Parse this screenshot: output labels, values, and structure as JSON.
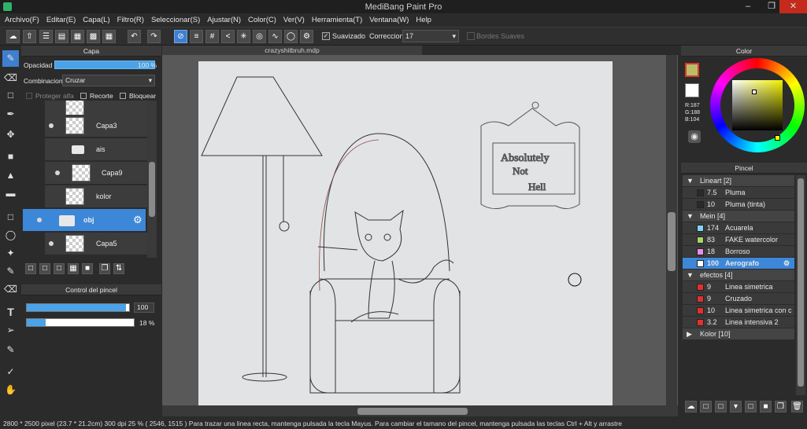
{
  "app": {
    "title": "MediBang Paint Pro"
  },
  "menu": [
    "Archivo(F)",
    "Editar(E)",
    "Capa(L)",
    "Filtro(R)",
    "Seleccionar(S)",
    "Ajustar(N)",
    "Color(C)",
    "Ver(V)",
    "Herramienta(T)",
    "Ventana(W)",
    "Help"
  ],
  "toolbar": {
    "smooth_label": "Suavizado",
    "correction_label": "Correccion",
    "correction_value": "17",
    "soft_edges_label": "Bordes Suaves"
  },
  "document": {
    "tab": "crazyshitbruh.mdp"
  },
  "layers_panel": {
    "title": "Capa",
    "opacity_label": "Opacidad",
    "opacity_value": "100 %",
    "blend_label": "Combinacion",
    "blend_value": "Cruzar",
    "protect_alpha": "Proteger alfa",
    "clipping": "Recorte",
    "lock": "Bloquear",
    "layers": [
      {
        "name": "Capa3"
      },
      {
        "name": "ais"
      },
      {
        "name": "Capa9"
      },
      {
        "name": "kolor"
      },
      {
        "name": "obj"
      },
      {
        "name": "Capa5"
      }
    ]
  },
  "brush_control": {
    "title": "Control del pincel",
    "size_value": "100",
    "opacity_value": "18 %",
    "size_fraction": 0.97,
    "opacity_fraction": 0.18
  },
  "color_panel": {
    "title": "Color",
    "r": "R:187",
    "g": "G:188",
    "b": "B:104"
  },
  "brush_panel": {
    "title": "Pincel",
    "groups": [
      {
        "name": "Lineart [2]",
        "items": [
          {
            "size": "7.5",
            "name": "Pluma",
            "color": "#2a2a2a"
          },
          {
            "size": "10",
            "name": "Pluma (tinta)",
            "color": "#2a2a2a"
          }
        ]
      },
      {
        "name": "Mein [4]",
        "items": [
          {
            "size": "174",
            "name": "Acuarela",
            "color": "#7fd4f0"
          },
          {
            "size": "83",
            "name": "FAKE watercolor",
            "color": "#a8d46a"
          },
          {
            "size": "18",
            "name": "Borroso",
            "color": "#e98ee8"
          },
          {
            "size": "100",
            "name": "Aerografo",
            "color": "#ffffff"
          }
        ]
      },
      {
        "name": "efectos [4]",
        "items": [
          {
            "size": "9",
            "name": "Linea simetrica",
            "color": "#e03030"
          },
          {
            "size": "9",
            "name": "Cruzado",
            "color": "#e03030"
          },
          {
            "size": "10",
            "name": "Linea simetrica con c",
            "color": "#e03030"
          },
          {
            "size": "3.2",
            "name": "Linea intensiva 2",
            "color": "#e03030"
          }
        ]
      },
      {
        "name": "Kolor [10]",
        "items": []
      }
    ]
  },
  "status": {
    "text": "2800 * 2500 pixel   (23.7 * 21.2cm)   300 dpi   25 %   ( 2546, 1515 )   Para trazar una linea recta, mantenga pulsada la tecla Mayus. Para cambiar el tamano del pincel, mantenga pulsada las teclas Ctrl + Alt y arrastre"
  }
}
